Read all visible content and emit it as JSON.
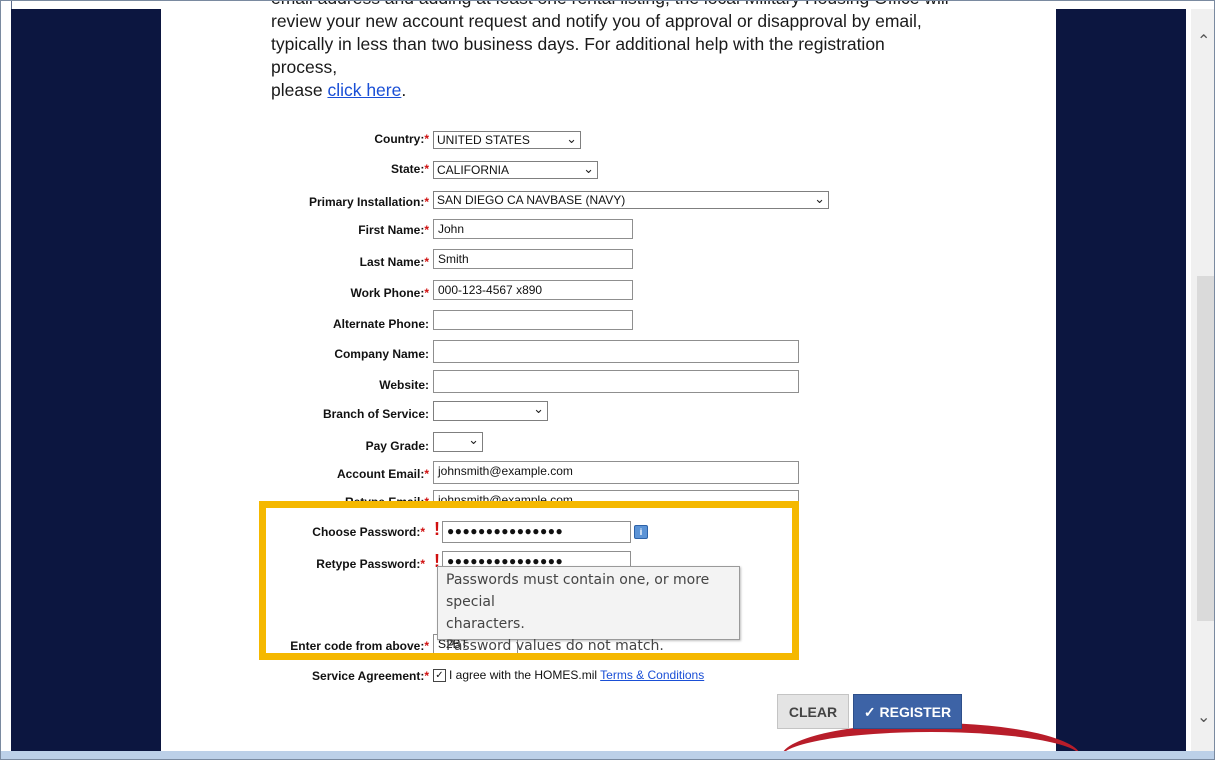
{
  "intro": {
    "cut_line": "email address and adding at least one rental listing, the local Military Housing Office will",
    "line1": "review your new account request and notify you of approval or disapproval by email,",
    "line2": "typically in less than two business days. For additional help with the registration process,",
    "line3_prefix": "please ",
    "link": "click here",
    "line3_suffix": "."
  },
  "required_marker": "*",
  "form": {
    "country": {
      "label": "Country:",
      "value": "UNITED STATES"
    },
    "state": {
      "label": "State:",
      "value": "CALIFORNIA"
    },
    "installation": {
      "label": "Primary Installation:",
      "value": "SAN DIEGO CA NAVBASE (NAVY)"
    },
    "first_name": {
      "label": "First Name:",
      "value": "John"
    },
    "last_name": {
      "label": "Last Name:",
      "value": "Smith"
    },
    "work_phone": {
      "label": "Work Phone:",
      "value": "000-123-4567 x890"
    },
    "alt_phone": {
      "label": "Alternate Phone:",
      "value": ""
    },
    "company": {
      "label": "Company Name:",
      "value": ""
    },
    "website": {
      "label": "Website:",
      "value": ""
    },
    "branch": {
      "label": "Branch of Service:",
      "value": ""
    },
    "pay_grade": {
      "label": "Pay Grade:",
      "value": ""
    },
    "email": {
      "label": "Account Email:",
      "value": "johnsmith@example.com"
    },
    "retype_email": {
      "label": "Retype Email:",
      "value": "johnsmith@example.com"
    },
    "password": {
      "label": "Choose Password:",
      "value": "●●●●●●●●●●●●●●●"
    },
    "retype_password": {
      "label": "Retype Password:",
      "value": "●●●●●●●●●●●●●●●"
    },
    "code": {
      "label": "Enter code from above:",
      "value": "S2BT"
    },
    "agreement": {
      "label": "Service Agreement:",
      "text": "I agree with the HOMES.mil ",
      "link": "Terms & Conditions",
      "checked": true
    }
  },
  "tooltip": {
    "line1": "Passwords must contain one, or more special",
    "line2": "characters.",
    "line3": "Password values do not match."
  },
  "buttons": {
    "clear": "CLEAR",
    "register": "REGISTER",
    "register_icon": "checkmark-icon"
  },
  "colors": {
    "side_panel": "#0c1640",
    "highlight": "#f5b800",
    "register_bg": "#3d63a6",
    "required": "#d01010",
    "link": "#1a4fd6"
  }
}
